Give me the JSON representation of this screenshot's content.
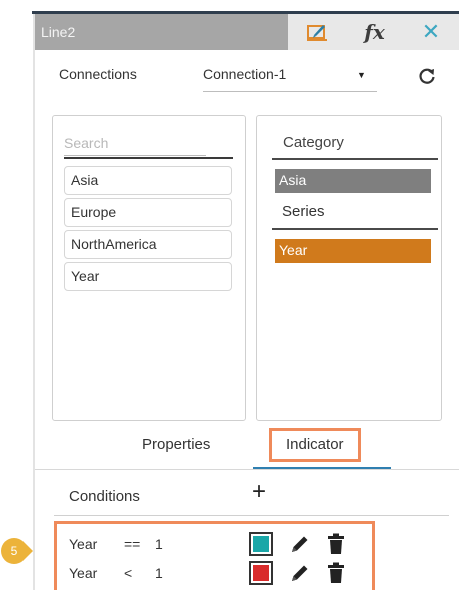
{
  "window": {
    "title": "Line2",
    "icons": [
      "chart-edit-icon",
      "fx-icon",
      "close-icon"
    ],
    "fx_label": "fx",
    "close_glyph": "✕"
  },
  "connection": {
    "label": "Connections",
    "selected": "Connection-1",
    "caret": "▼",
    "refresh_glyph": "↻"
  },
  "fields": {
    "search_placeholder": "Search",
    "items": [
      "Asia",
      "Europe",
      "NorthAmerica",
      "Year"
    ]
  },
  "category": {
    "header": "Category",
    "selected_item": "Asia",
    "series_label": "Series",
    "series_item": "Year"
  },
  "tabs": {
    "properties": "Properties",
    "indicator": "Indicator",
    "active": "Indicator"
  },
  "conditions": {
    "label": "Conditions",
    "add_glyph": "+",
    "rows": [
      {
        "field": "Year",
        "operator": "==",
        "value": "1",
        "color": "#1aa7a8"
      },
      {
        "field": "Year",
        "operator": "<",
        "value": "1",
        "color": "#d92b2b"
      }
    ]
  },
  "annotation": {
    "step": "5"
  },
  "colors": {
    "accent_blue": "#2f7fb0",
    "highlight_orange": "#ef8a5a",
    "series_orange": "#d07a1c",
    "badge_yellow": "#ecb33a",
    "titlebar_gray": "#a6a6a6"
  }
}
